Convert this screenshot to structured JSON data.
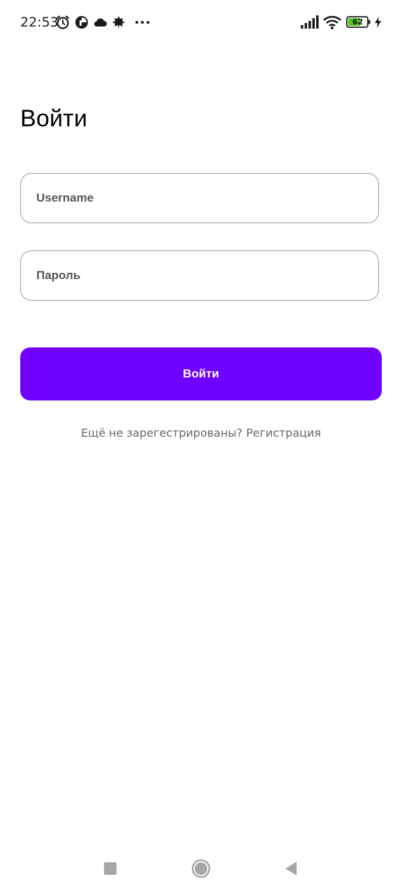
{
  "status_bar": {
    "time": "22:53",
    "battery_level": "62",
    "left_icons": [
      "alarm-icon",
      "app-status-icon",
      "cloud-icon",
      "leaf-icon",
      "more-dots-icon"
    ],
    "right_icons": [
      "signal-icon",
      "wifi-icon",
      "battery-icon",
      "charging-icon"
    ]
  },
  "login": {
    "title": "Войти",
    "username_placeholder": "Username",
    "password_placeholder": "Пароль",
    "submit_label": "Войти",
    "register_prompt": "Ещё не зарегестрированы?",
    "register_link": "Регистрация"
  },
  "colors": {
    "accent": "#7000ff",
    "field_border": "#9a9a9a",
    "secondary_text": "#666666"
  },
  "nav_bar": {
    "icons": [
      "recents-square-icon",
      "home-circle-icon",
      "back-triangle-icon"
    ]
  }
}
